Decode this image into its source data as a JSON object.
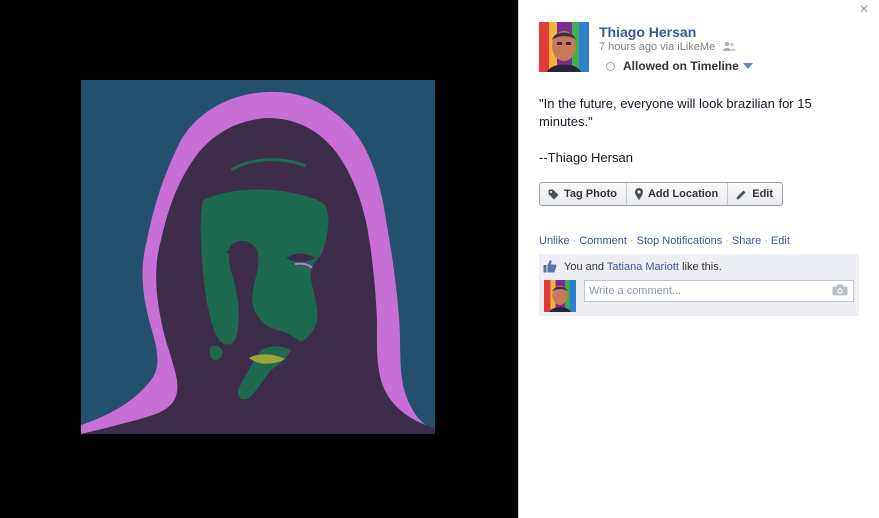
{
  "post": {
    "author": "Thiago Hersan",
    "time": "7 hours ago",
    "via": "via iLikeMe",
    "visibility": "Allowed on Timeline",
    "caption_quote": "\"In the future, everyone will look brazilian for 15 minutes.\"",
    "caption_attribution": "--Thiago Hersan"
  },
  "actions": {
    "tag_photo": "Tag Photo",
    "add_location": "Add Location",
    "edit": "Edit"
  },
  "links": [
    "Unlike",
    "Comment",
    "Stop Notifications",
    "Share",
    "Edit"
  ],
  "likes": {
    "prefix": "You and",
    "person": "Tatiana Mariott",
    "suffix": "like this."
  },
  "comment": {
    "placeholder": "Write a comment..."
  },
  "icons": {
    "close": "close-icon",
    "audience": "friends-icon",
    "visibility": "circle-icon",
    "dropdown": "caret-down-icon",
    "tag": "tag-icon",
    "location": "location-pin-icon",
    "edit": "pencil-icon",
    "like": "thumbs-up-icon",
    "camera": "camera-icon"
  },
  "colors": {
    "link": "#3b5998",
    "photo_bg": "#23506f",
    "photo_magenta": "#c86fd6",
    "photo_face": "#3d2d4a",
    "photo_green": "#1e6a50",
    "photo_lips": "#9ea438",
    "likes_bg": "#edeff4"
  }
}
